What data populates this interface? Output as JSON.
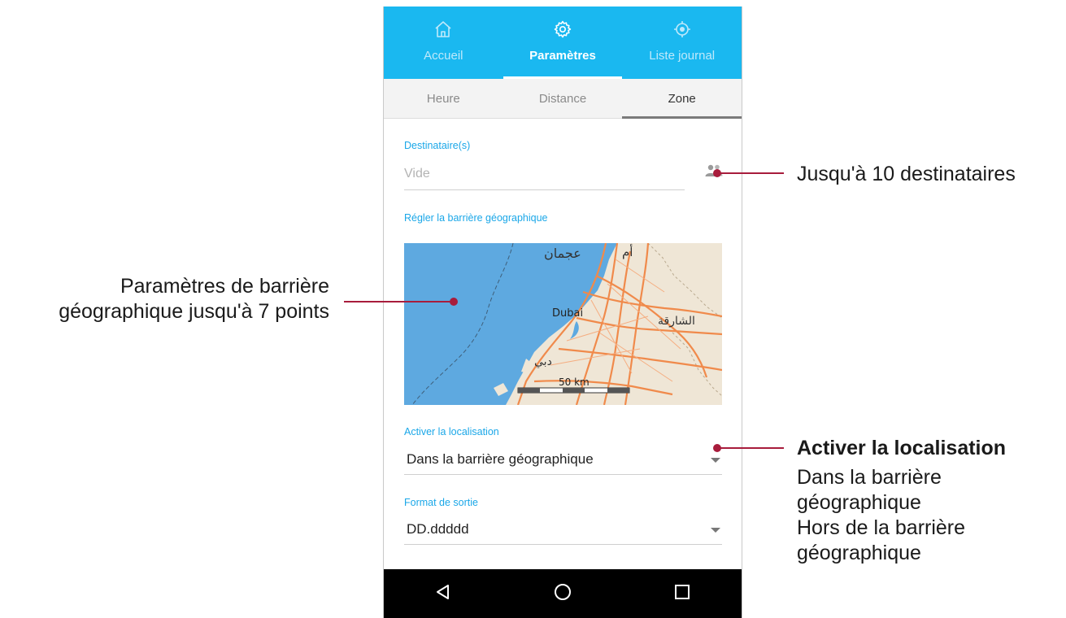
{
  "nav": {
    "tabs": [
      {
        "label": "Accueil",
        "icon": "home-icon",
        "active": false
      },
      {
        "label": "Paramètres",
        "icon": "settings-gear-icon",
        "active": true
      },
      {
        "label": "Liste journal",
        "icon": "location-target-icon",
        "active": false
      }
    ]
  },
  "subtabs": [
    {
      "label": "Heure",
      "active": false
    },
    {
      "label": "Distance",
      "active": false
    },
    {
      "label": "Zone",
      "active": true
    }
  ],
  "recipients": {
    "label": "Destinataire(s)",
    "placeholder": "Vide",
    "icon": "contacts-icon"
  },
  "geofence": {
    "label": "Régler la barrière géographique",
    "map_labels": {
      "ajman": "عجمان",
      "umm": "أم",
      "dubai": "Dubai",
      "sharjah": "الشارقة",
      "dubai_ar": "دبي",
      "scale": "50 km"
    }
  },
  "activation": {
    "label": "Activer la localisation",
    "value": "Dans la barrière géographique"
  },
  "output_format": {
    "label": "Format de sortie",
    "value": "DD.ddddd"
  },
  "system_nav": [
    "back-icon",
    "home-circle-icon",
    "recents-square-icon"
  ],
  "annotations": {
    "recipients_note": "Jusqu'à 10 destinataires",
    "geofence_note_line1": "Paramètres de barrière",
    "geofence_note_line2": "géographique jusqu'à 7 points",
    "activation_title": "Activer la localisation",
    "activation_option_1_line1": "Dans la barrière",
    "activation_option_1_line2": "géographique",
    "activation_option_2_line1": "Hors de la barrière",
    "activation_option_2_line2": "géographique"
  },
  "colors": {
    "accent": "#1ab8f0",
    "annotation": "#a81c3c",
    "sea": "#5ea9e0",
    "land": "#efe6d6",
    "road": "#f08a4b",
    "system_bar": "#000000"
  }
}
